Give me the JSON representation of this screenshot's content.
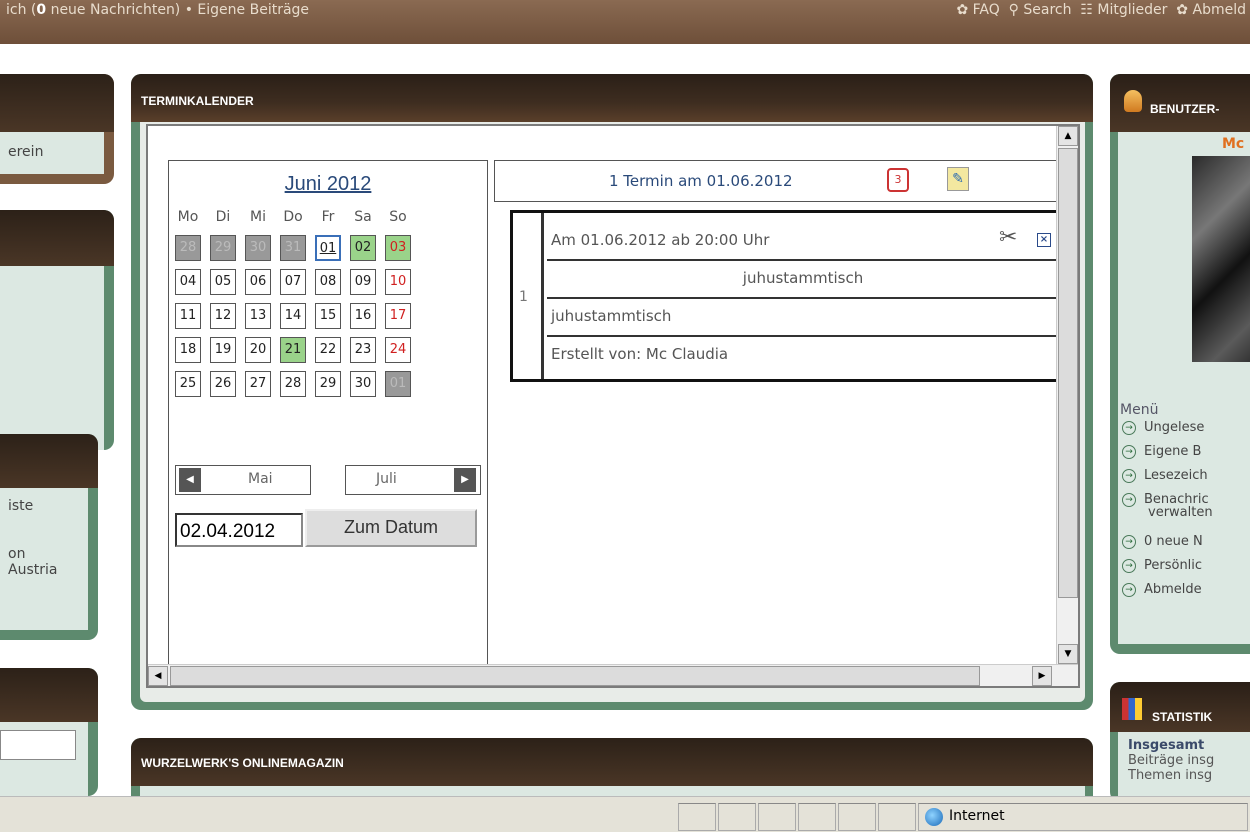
{
  "topbar": {
    "left_prefix": "ich (",
    "left_count": "0",
    "left_suffix": " neue Nachrichten) • Eigene Beiträge",
    "faq": "FAQ",
    "search": "Search",
    "members": "Mitglieder",
    "logout": "Abmeld"
  },
  "left_sidebar": {
    "item1": "erein",
    "item2": "iste",
    "item3": "on",
    "item4": "Austria"
  },
  "calendar_panel": {
    "title": "TERMINKALENDER",
    "month_title": "Juni 2012",
    "weekdays": [
      "Mo",
      "Di",
      "Mi",
      "Do",
      "Fr",
      "Sa",
      "So"
    ],
    "weeks": [
      [
        "28",
        "29",
        "30",
        "31",
        "01",
        "02",
        "03"
      ],
      [
        "04",
        "05",
        "06",
        "07",
        "08",
        "09",
        "10"
      ],
      [
        "11",
        "12",
        "13",
        "14",
        "15",
        "16",
        "17"
      ],
      [
        "18",
        "19",
        "20",
        "21",
        "22",
        "23",
        "24"
      ],
      [
        "25",
        "26",
        "27",
        "28",
        "29",
        "30",
        "01"
      ]
    ],
    "prev_month": "Mai",
    "next_month": "Juli",
    "date_value": "02.04.2012",
    "go_button": "Zum Datum"
  },
  "events": {
    "header": "1 Termin am 01.06.2012",
    "row_number": "1",
    "when": "Am 01.06.2012 ab 20:00 Uhr",
    "title": "juhustammtisch",
    "description": "juhustammtisch",
    "created_by": "Erstellt von: Mc Claudia"
  },
  "magazine_panel": {
    "title": "WURZELWERK'S ONLINEMAGAZIN"
  },
  "user_panel": {
    "title": "BENUTZER-",
    "username": "Mc",
    "menu_label": "Menü",
    "menu_items": [
      "Ungelese",
      "Eigene B",
      "Lesezeich",
      "Benachric",
      "verwalten",
      "0 neue N",
      "Persönlic",
      "Abmelde"
    ]
  },
  "stats_panel": {
    "title": "STATISTIK",
    "total_label": "Insgesamt",
    "posts_label": "Beiträge insg",
    "topics_label": "Themen insg"
  },
  "statusbar": {
    "zone": "Internet"
  },
  "colors": {
    "header_brown": "#3e2d20",
    "panel_green": "#5d8a6e",
    "panel_bg": "#dce8e2",
    "today_green": "#9ad38a",
    "sunday_red": "#d02020",
    "link_blue": "#2a4a7a"
  }
}
